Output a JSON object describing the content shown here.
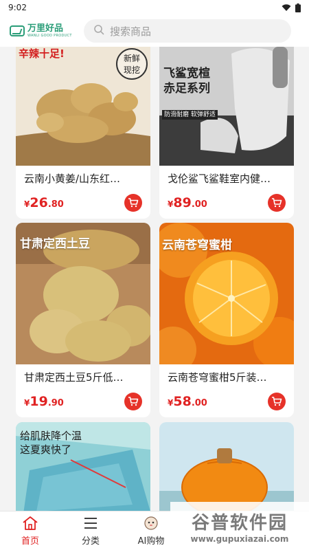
{
  "status_bar": {
    "time": "9:02"
  },
  "header": {
    "logo_cn": "万里好品",
    "logo_en": "WANLI GOOD PRODUCT",
    "search_placeholder": "搜索商品"
  },
  "products": [
    {
      "title": "云南小黄姜/山东红…",
      "price_symbol": "¥",
      "price_int": "26",
      "price_dec": ".80",
      "image_texts": [
        "辛辣十足!",
        "新鲜",
        "现挖"
      ]
    },
    {
      "title": "戈伦鲨飞鲨鞋室内健…",
      "price_symbol": "¥",
      "price_int": "89",
      "price_dec": ".00",
      "image_texts": [
        "飞鲨宽楦",
        "赤足系列",
        "防滑耐磨 软弹舒适"
      ]
    },
    {
      "title": "甘肃定西土豆5斤低…",
      "price_symbol": "¥",
      "price_int": "19",
      "price_dec": ".90",
      "image_texts": [
        "甘肃定西土豆"
      ]
    },
    {
      "title": "云南苍穹蜜柑5斤装…",
      "price_symbol": "¥",
      "price_int": "58",
      "price_dec": ".00",
      "image_texts": [
        "云南苍穹蜜柑"
      ]
    },
    {
      "title": "",
      "image_texts": [
        "给肌肤降个温",
        "这夏爽快了"
      ]
    },
    {
      "title": "",
      "image_texts": []
    }
  ],
  "tabs": [
    {
      "label": "首页",
      "icon": "home-icon",
      "active": true
    },
    {
      "label": "分类",
      "icon": "list-icon",
      "active": false
    },
    {
      "label": "AI购物",
      "icon": "ai-mascot-icon",
      "active": false
    }
  ],
  "watermark": {
    "cn": "谷普软件园",
    "url": "www.gupuxiazai.com"
  },
  "colors": {
    "accent": "#e02222",
    "brand": "#2a9d78"
  }
}
